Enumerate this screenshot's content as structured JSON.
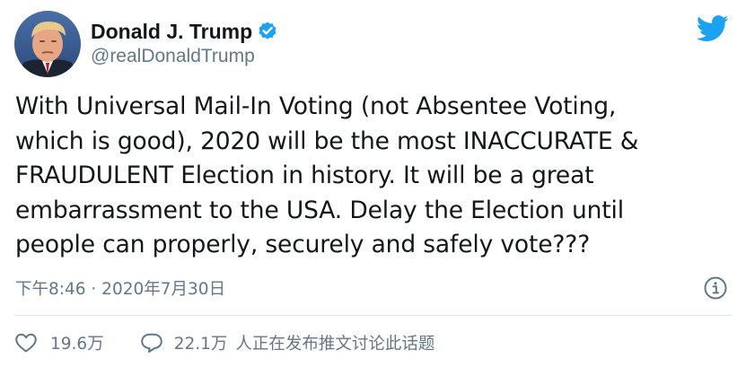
{
  "author": {
    "display_name": "Donald J. Trump",
    "handle": "@realDonaldTrump",
    "verified": true,
    "avatar": "profile-photo"
  },
  "tweet": {
    "lines": [
      "With Universal Mail-In Voting (not Absentee Voting,",
      "which is good), 2020 will be the most INACCURATE &",
      "FRAUDULENT Election in history. It will be a great",
      "embarrassment to the USA. Delay the Election until",
      "people can properly, securely and safely vote???"
    ],
    "timestamp": "下午8:46 · 2020年7月30日"
  },
  "actions": {
    "like_count": "19.6万",
    "reply_count": "22.1万",
    "reply_label": "人正在发布推文讨论此话题"
  },
  "icons": {
    "brand": "twitter-bird-icon",
    "verified": "verified-badge-icon",
    "info": "info-icon",
    "like": "heart-icon",
    "reply": "speech-bubble-icon"
  },
  "colors": {
    "brand_blue": "#1da1f2",
    "text_primary": "#14171a",
    "text_secondary": "#657786",
    "divider": "#e1e8ed"
  }
}
